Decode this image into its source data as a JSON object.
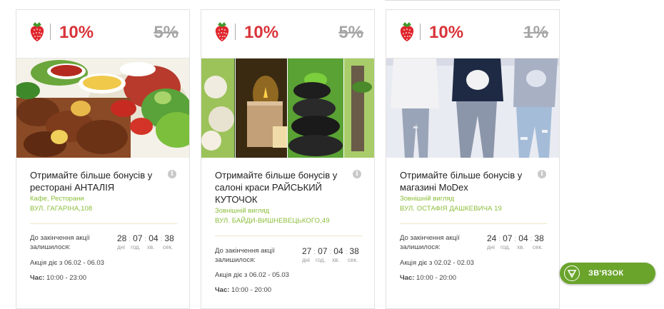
{
  "colors": {
    "accent": "#d8343a",
    "muted": "#a6a6a6",
    "green": "#8bbd3a",
    "button": "#6aa42b"
  },
  "cards": [
    {
      "discount": "10%",
      "old_discount": "5%",
      "title": "Отримайте більше бонусів у ресторані АНТАЛІЯ",
      "category": "Кафе, Ресторани",
      "address": "ВУЛ. ГАГАРІНА,108",
      "until_label": "До закінчення акції залишилося:",
      "timer": {
        "days": "28",
        "hours": "07",
        "minutes": "04",
        "seconds": "38"
      },
      "period": "Акція діє з 06.02 - 06.03",
      "hours_label": "Час:",
      "hours_value": "10:00 - 23:00",
      "image": "kebab-food-photo"
    },
    {
      "discount": "10%",
      "old_discount": "5%",
      "title": "Отримайте більше бонусів у салоні краси РАЙСЬКИЙ КУТОЧОК",
      "category": "Зовнішній вигляд",
      "address": "ВУЛ. БАЙДИ-ВИШНЕВЕЦЬКОГО,49",
      "until_label": "До закінчення акції залишилося:",
      "timer": {
        "days": "27",
        "hours": "07",
        "minutes": "04",
        "seconds": "38"
      },
      "period": "Акція діє з 06.02 - 05.03",
      "hours_label": "Час:",
      "hours_value": "10:00 - 20:00",
      "image": "spa-stones-photo"
    },
    {
      "discount": "10%",
      "old_discount": "1%",
      "title": "Отримайте більше бонусів у магазині MoDex",
      "category": "Зовнішній вигляд",
      "address": "ВУЛ. ОСТАФІЯ ДАШКЕВИЧА 19",
      "until_label": "До закінчення акції залишилося:",
      "timer": {
        "days": "24",
        "hours": "07",
        "minutes": "04",
        "seconds": "38"
      },
      "period": "Акція діє з 02.02 - 02.03",
      "hours_label": "Час:",
      "hours_value": "10:00 - 20:00",
      "image": "fashion-models-photo"
    }
  ],
  "timer_units": {
    "days": "дні",
    "hours": "год.",
    "minutes": "хв.",
    "seconds": "сек."
  },
  "contact": {
    "label": "ЗВ'ЯЗОК",
    "icon": "contact-logo-icon"
  }
}
